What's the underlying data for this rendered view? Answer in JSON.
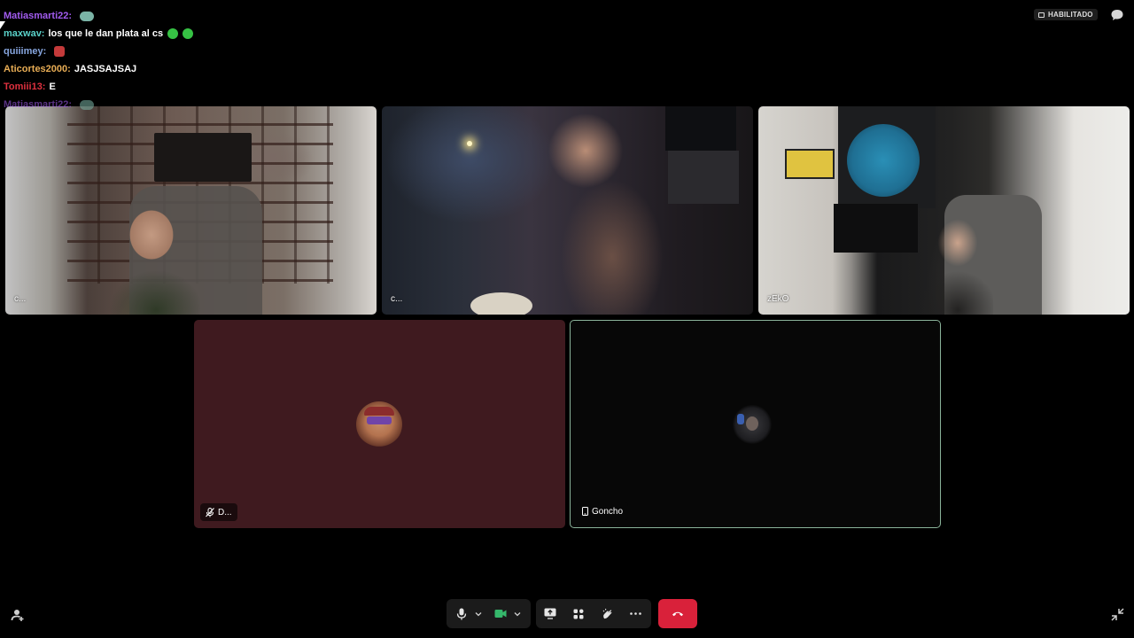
{
  "chat": {
    "messages": [
      {
        "user": "Matiasmarti22",
        "user_color": "#a25cf0",
        "text": "",
        "emotes": [
          "teal"
        ],
        "faded": false
      },
      {
        "user": "maxwav",
        "user_color": "#5ad1c9",
        "text": "los que le dan plata al cs",
        "emotes": [
          "green",
          "green"
        ],
        "faded": false
      },
      {
        "user": "quiiimey",
        "user_color": "#87a6df",
        "text": "",
        "emotes": [
          "red"
        ],
        "faded": false
      },
      {
        "user": "Aticortes2000",
        "user_color": "#e8ad55",
        "text": "JASJSAJSAJ",
        "emotes": [],
        "faded": false
      },
      {
        "user": "Tomiii13",
        "user_color": "#e0313f",
        "text": "E",
        "emotes": [],
        "faded": false
      },
      {
        "user": "Matiasmarti22",
        "user_color": "#a25cf0",
        "text": "",
        "emotes": [
          "teal"
        ],
        "faded": true
      }
    ]
  },
  "header": {
    "status_badge": "HABILITADO"
  },
  "participants": {
    "cam1": {
      "name": "c..."
    },
    "cam2": {
      "name": "c..."
    },
    "cam3": {
      "name": "zEkO"
    },
    "tile_d": {
      "name": "D...",
      "background": "#3f1a1f",
      "muted": true
    },
    "tile_g": {
      "name": "Goncho",
      "device": "phone-icon",
      "active_speaker_border": "#8ab39a"
    }
  },
  "controls": {
    "mic": "microphone-icon",
    "camera": "video-camera-icon",
    "camera_color": "#35b86b",
    "share": "screen-share-icon",
    "apps": "apps-icon",
    "reactions": "reactions-icon",
    "more": "more-options-icon",
    "leave": "hang-up-icon",
    "leave_color": "#d9213a"
  }
}
